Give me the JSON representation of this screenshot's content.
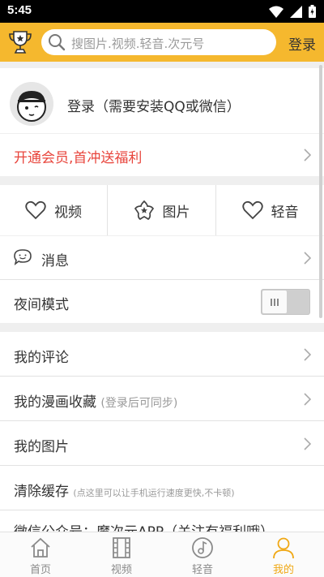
{
  "status_bar": {
    "time": "5:45"
  },
  "header": {
    "search_placeholder": "搜图片.视频.轻音.次元号",
    "login_label": "登录"
  },
  "profile": {
    "login_prompt": "登录（需要安装QQ或微信）"
  },
  "vip": {
    "label": "开通会员,首冲送福利",
    "color": "#e8453c"
  },
  "shortcuts": [
    {
      "label": "视频",
      "icon": "heart-icon"
    },
    {
      "label": "图片",
      "icon": "star-flower-icon"
    },
    {
      "label": "轻音",
      "icon": "heart-icon"
    }
  ],
  "menu": {
    "messages": "消息",
    "night_mode": "夜间模式",
    "night_mode_on": false,
    "my_comments": "我的评论",
    "my_comics": "我的漫画收藏",
    "my_comics_hint": "(登录后可同步)",
    "my_images": "我的图片",
    "clear_cache": "清除缓存",
    "clear_cache_hint": "(点这里可以让手机运行速度更快,不卡顿)",
    "wechat": "微信公众号：魔次元APP（关注有福利哦）"
  },
  "bottom_nav": [
    {
      "label": "首页",
      "icon": "home-icon",
      "active": false
    },
    {
      "label": "视频",
      "icon": "film-icon",
      "active": false
    },
    {
      "label": "轻音",
      "icon": "music-note-icon",
      "active": false
    },
    {
      "label": "我的",
      "icon": "person-icon",
      "active": true
    }
  ],
  "colors": {
    "accent": "#f5b82e",
    "active_nav": "#f0a814"
  }
}
